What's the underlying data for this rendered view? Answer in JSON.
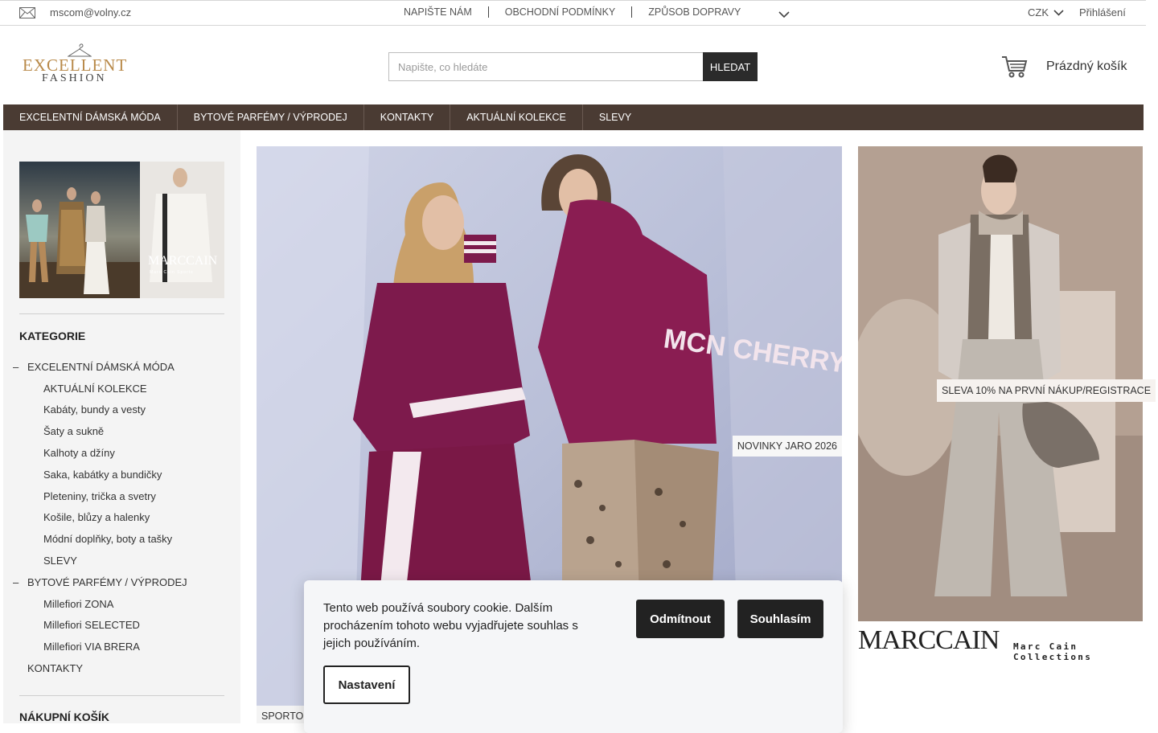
{
  "topbar": {
    "email": "mscom@volny.cz",
    "links": [
      "NAPIŠTE NÁM",
      "OBCHODNÍ PODMÍNKY",
      "ZPŮSOB DOPRAVY"
    ],
    "currency": "CZK",
    "login": "Přihlášení"
  },
  "header": {
    "logo_line1": "EXCELLENT",
    "logo_line2": "FASHION",
    "search_placeholder": "Napište, co hledáte",
    "search_button": "HLEDAT",
    "cart_label": "Prázdný košík"
  },
  "nav": [
    "EXCELENTNÍ DÁMSKÁ MÓDA",
    "BYTOVÉ PARFÉMY / VÝPRODEJ",
    "KONTAKTY",
    "AKTUÁLNÍ KOLEKCE",
    "SLEVY"
  ],
  "sidebar": {
    "banner_brand": "MARCCAIN",
    "banner_sub": "Marc Cain Sports",
    "categories_heading": "KATEGORIE",
    "categories": [
      {
        "label": "EXCELENTNÍ DÁMSKÁ MÓDA",
        "level": 0,
        "expanded": true
      },
      {
        "label": "AKTUÁLNÍ KOLEKCE",
        "level": 1
      },
      {
        "label": "Kabáty, bundy a vesty",
        "level": 1
      },
      {
        "label": "Šaty a sukně",
        "level": 1
      },
      {
        "label": "Kalhoty a džíny",
        "level": 1
      },
      {
        "label": "Saka, kabátky a bundičky",
        "level": 1
      },
      {
        "label": "Pleteniny, trička a svetry",
        "level": 1
      },
      {
        "label": "Košile, blůzy a halenky",
        "level": 1
      },
      {
        "label": "Módní doplňky, boty a tašky",
        "level": 1
      },
      {
        "label": "SLEVY",
        "level": 1
      },
      {
        "label": "BYTOVÉ PARFÉMY / VÝPRODEJ",
        "level": 0,
        "expanded": true
      },
      {
        "label": "Millefiori ZONA",
        "level": 1
      },
      {
        "label": "Millefiori SELECTED",
        "level": 1
      },
      {
        "label": "Millefiori VIA BRERA",
        "level": 1
      },
      {
        "label": "KONTAKTY",
        "level": 0
      }
    ],
    "cart_heading": "NÁKUPNÍ KOŠÍK"
  },
  "hero": {
    "tag": "NOVINKY JARO 2026",
    "jacket_print": "MCN CHERRY",
    "caption2": "SPORTO"
  },
  "promo": {
    "tag": "SLEVA 10% NA PRVNÍ NÁKUP/REGISTRACE",
    "brand": "MARCCAIN",
    "brand_sub": "Marc Cain Collections"
  },
  "cookie": {
    "text": "Tento web používá soubory cookie. Dalším procházením tohoto webu vyjadřujete souhlas s jejich používáním.",
    "decline": "Odmítnout",
    "accept": "Souhlasím",
    "settings": "Nastavení"
  },
  "colors": {
    "nav_bg": "#4a3b33",
    "logo_gold": "#b98a4a",
    "button_dark": "#2b2b2b"
  }
}
